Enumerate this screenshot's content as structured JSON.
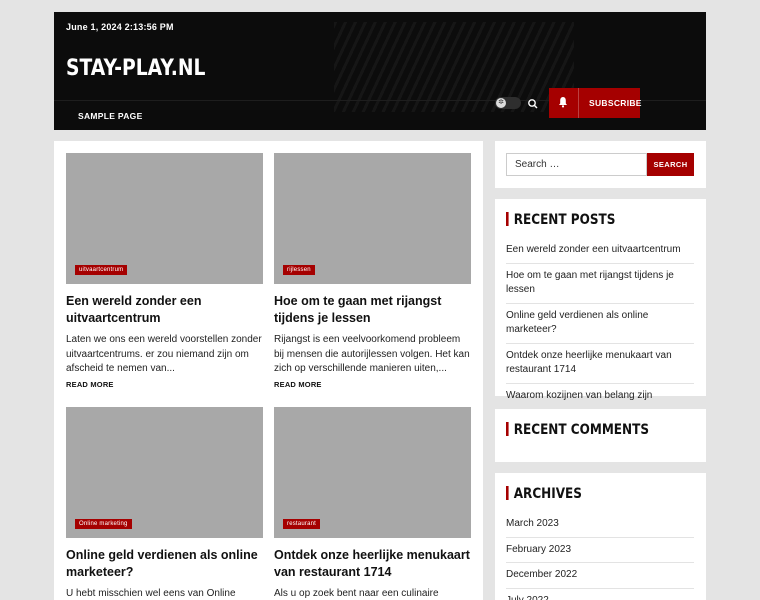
{
  "header": {
    "date": "June 1, 2024 2:13:56 PM",
    "site_title": "STAY-PLAY.NL",
    "nav": [
      {
        "label": "SAMPLE PAGE"
      }
    ],
    "subscribe_label": "SUBSCRIBE"
  },
  "posts": [
    {
      "category": "uitvaartcentrum",
      "title": "Een wereld zonder een uitvaartcentrum",
      "excerpt": "Laten we ons een wereld voorstellen zonder uitvaartcentrums. er zou niemand zijn om afscheid te nemen van...",
      "read_more": "READ MORE"
    },
    {
      "category": "rijlessen",
      "title": "Hoe om te gaan met rijangst tijdens je lessen",
      "excerpt": "Rijangst is een veelvoorkomend probleem bij mensen die autorijlessen volgen. Het kan zich op verschillende manieren uiten,...",
      "read_more": "READ MORE"
    },
    {
      "category": "Online marketing",
      "title": "Online geld verdienen als online marketeer?",
      "excerpt": "U hebt misschien wel eens van Online",
      "read_more": ""
    },
    {
      "category": "restaurant",
      "title": "Ontdek onze heerlijke menukaart van restaurant 1714",
      "excerpt": "Als u op zoek bent naar een culinaire ervaring",
      "read_more": ""
    }
  ],
  "sidebar": {
    "search": {
      "placeholder": "Search …",
      "button": "SEARCH"
    },
    "recent_posts": {
      "title": "RECENT POSTS",
      "items": [
        "Een wereld zonder een uitvaartcentrum",
        "Hoe om te gaan met rijangst tijdens je lessen",
        "Online geld verdienen als online marketeer?",
        "Ontdek onze heerlijke menukaart van restaurant 1714",
        "Waarom kozijnen van belang zijn"
      ]
    },
    "recent_comments": {
      "title": "RECENT COMMENTS"
    },
    "archives": {
      "title": "ARCHIVES",
      "items": [
        "March 2023",
        "February 2023",
        "December 2022",
        "July 2022"
      ]
    }
  },
  "colors": {
    "accent": "#a50000",
    "header_bg": "#0c0c0c",
    "page_bg": "#e4e4e4"
  },
  "icons": [
    "theme-toggle-icon",
    "search-icon",
    "bell-icon"
  ]
}
